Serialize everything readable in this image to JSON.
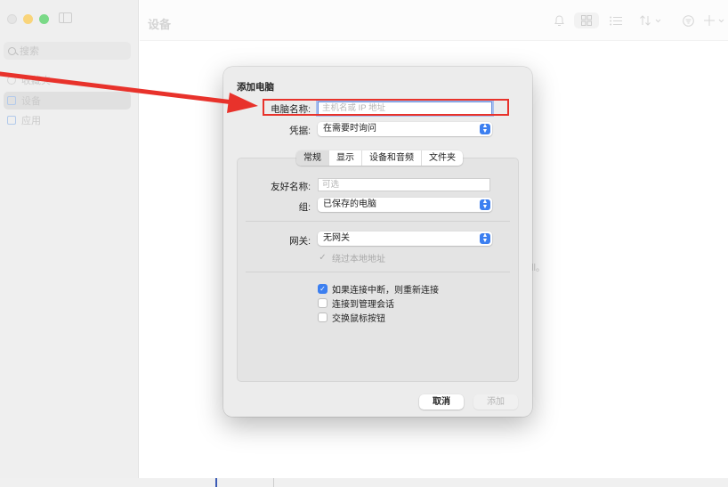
{
  "window": {
    "title": "设备"
  },
  "sidebar": {
    "search_placeholder": "搜索",
    "items": [
      {
        "label": "收藏夹"
      },
      {
        "label": "设备"
      },
      {
        "label": "应用"
      }
    ]
  },
  "background_hint": "ll。",
  "dialog": {
    "title": "添加电脑",
    "pc_name_label": "电脑名称:",
    "pc_name_placeholder": "主机名或 IP 地址",
    "credentials_label": "凭据:",
    "credentials_value": "在需要时询问",
    "tabs": [
      {
        "label": "常规",
        "active": true
      },
      {
        "label": "显示"
      },
      {
        "label": "设备和音频"
      },
      {
        "label": "文件夹"
      }
    ],
    "friendly_name_label": "友好名称:",
    "friendly_name_placeholder": "可选",
    "group_label": "组:",
    "group_value": "已保存的电脑",
    "gateway_label": "网关:",
    "gateway_value": "无网关",
    "bypass_label": "绕过本地地址",
    "reconnect_label": "如果连接中断，则重新连接",
    "admin_session_label": "连接到管理会话",
    "swap_mouse_label": "交换鼠标按钮",
    "cancel_button": "取消",
    "add_button": "添加"
  },
  "colors": {
    "accent": "#3c7ff0",
    "annotation": "#e8322b"
  }
}
